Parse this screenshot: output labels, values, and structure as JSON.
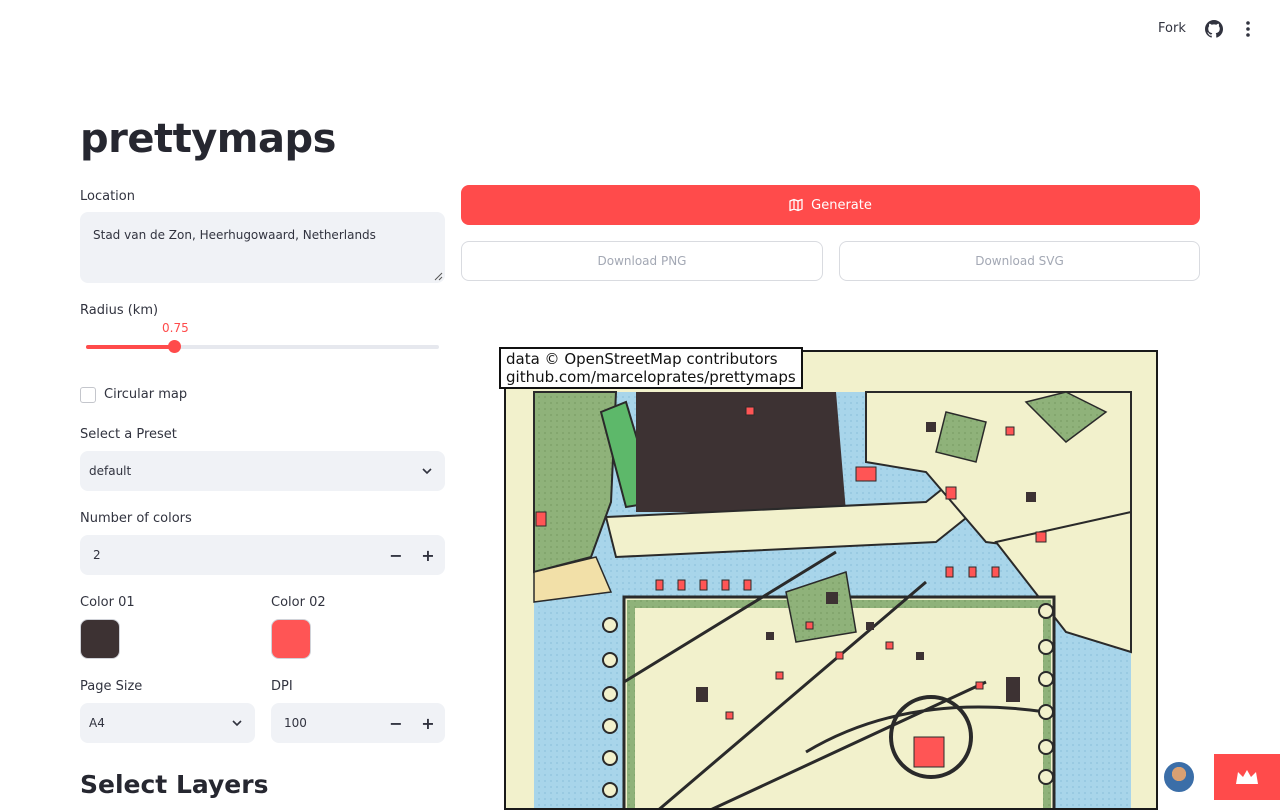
{
  "header": {
    "fork_label": "Fork"
  },
  "app": {
    "title": "prettymaps"
  },
  "location": {
    "label": "Location",
    "value": "Stad van de Zon, Heerhugowaard, Netherlands"
  },
  "radius": {
    "label": "Radius (km)",
    "value": "0.75",
    "fraction": 0.25
  },
  "circular": {
    "label": "Circular map",
    "checked": false
  },
  "preset": {
    "label": "Select a Preset",
    "value": "default"
  },
  "num_colors": {
    "label": "Number of colors",
    "value": "2"
  },
  "colors": [
    {
      "label": "Color 01",
      "hex": "#3d3233"
    },
    {
      "label": "Color 02",
      "hex": "#ff5555"
    }
  ],
  "page_size": {
    "label": "Page Size",
    "value": "A4"
  },
  "dpi": {
    "label": "DPI",
    "value": "100"
  },
  "layers": {
    "heading": "Select Layers"
  },
  "actions": {
    "generate": "Generate",
    "download_png": "Download PNG",
    "download_svg": "Download SVG"
  },
  "map": {
    "attribution_line1": "data © OpenStreetMap contributors",
    "attribution_line2": "github.com/marceloprates/prettymaps"
  },
  "theme": {
    "accent": "#ff4b4b",
    "input_bg": "#f0f2f6"
  }
}
